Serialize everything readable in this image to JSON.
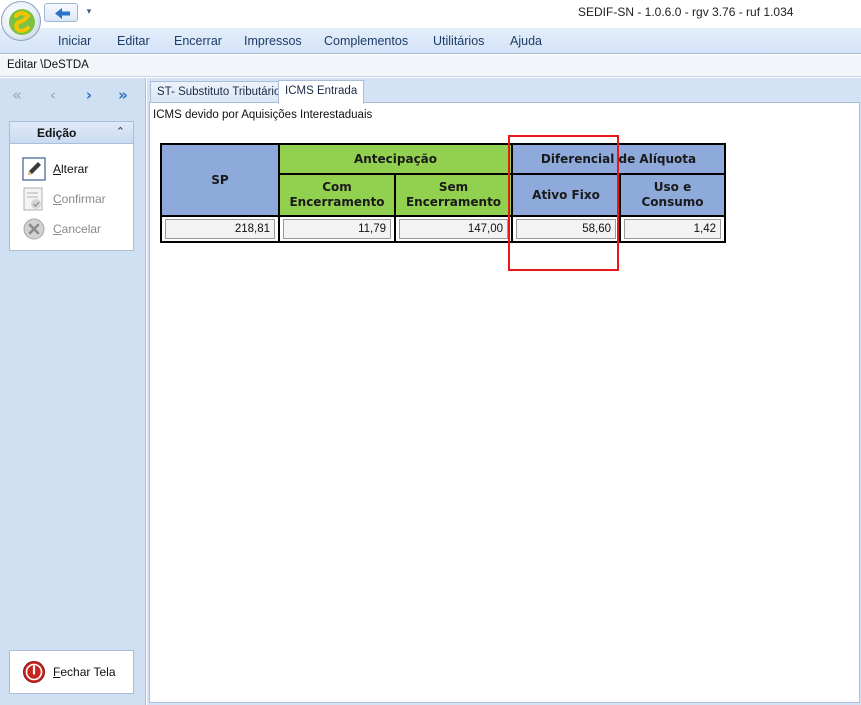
{
  "window": {
    "title": "SEDIF-SN - 1.0.6.0 - rgv 3.76 - ruf 1.034"
  },
  "quick_access": {
    "back_icon": "arrow-left-icon",
    "dropdown_glyph": "▾"
  },
  "menu": {
    "items": [
      "Iniciar",
      "Editar",
      "Encerrar",
      "Impressos",
      "Complementos",
      "Utilitários",
      "Ajuda"
    ]
  },
  "breadcrumb": "Editar \\DeSTDA",
  "nav": {
    "first": "«",
    "prev": "‹",
    "next": "›",
    "last": "»"
  },
  "edit_group": {
    "title": "Edição",
    "collapse_glyph": "⌃",
    "actions": [
      {
        "label_rest": "lterar",
        "hotkey": "A",
        "icon": "pencil-icon",
        "enabled": true
      },
      {
        "label_rest": "onfirmar",
        "hotkey": "C",
        "icon": "confirm-icon",
        "enabled": false
      },
      {
        "label_rest": "ancelar",
        "hotkey": "C",
        "icon": "cancel-icon",
        "enabled": false
      }
    ]
  },
  "close_screen": {
    "hotkey": "F",
    "label_rest": "echar Tela",
    "icon": "power-icon"
  },
  "tabs": [
    {
      "label": "ST- Substituto Tributário",
      "active": false
    },
    {
      "label": "ICMS Entrada",
      "active": true
    }
  ],
  "page": {
    "caption": "ICMS devido por Aquisições Interestaduais"
  },
  "table": {
    "headers": {
      "sp": "SP",
      "antecipacao": "Antecipação",
      "com_encerramento": "Com\nEncerramento",
      "sem_encerramento": "Sem\nEncerramento",
      "diferencial": "Diferencial de Alíquota",
      "ativo_fixo": "Ativo Fixo",
      "uso_consumo": "Uso e\nConsumo"
    },
    "values": {
      "sp": "218,81",
      "com_encerramento": "11,79",
      "sem_encerramento": "147,00",
      "ativo_fixo": "58,60",
      "uso_consumo": "1,42"
    }
  },
  "colors": {
    "header_blue": "#8eaadb",
    "header_green": "#92d050",
    "highlight_red": "#e81818",
    "menu_text": "#1e3c66"
  }
}
